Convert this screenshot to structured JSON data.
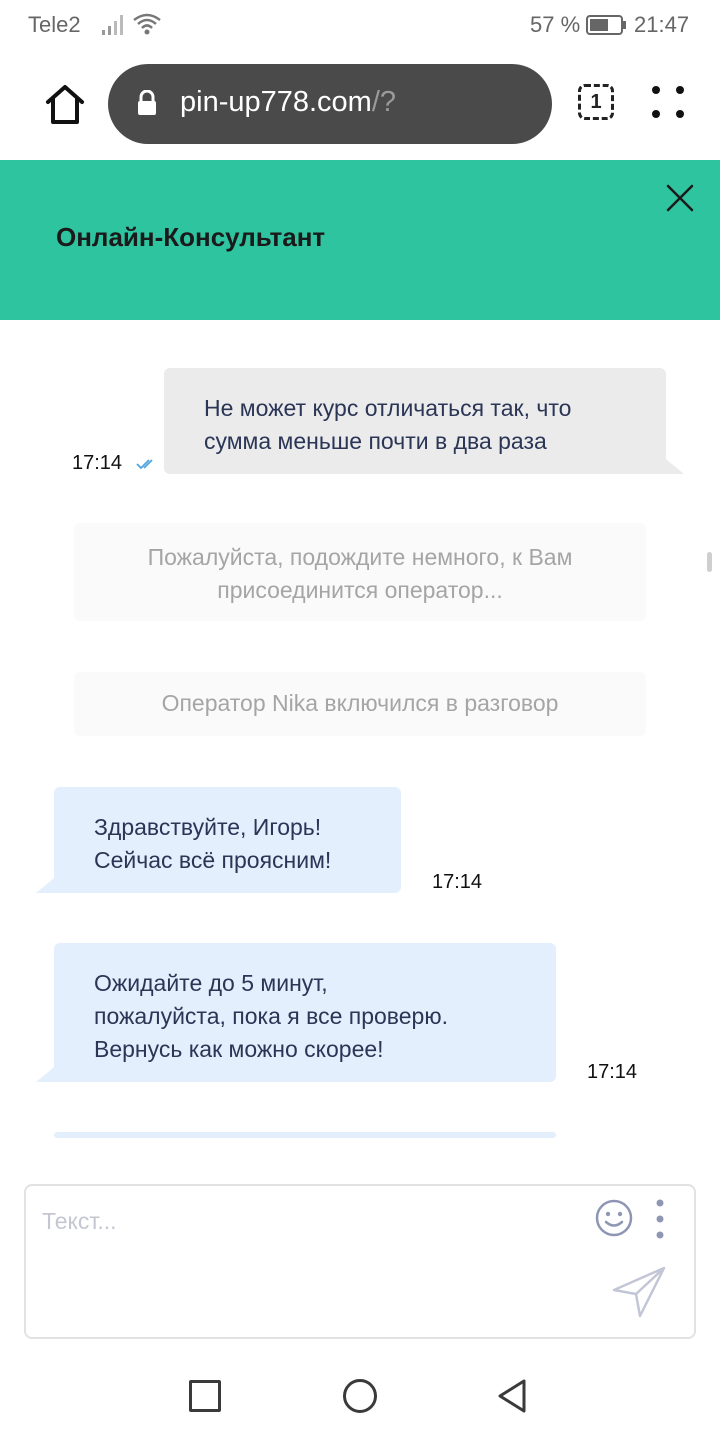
{
  "status_bar": {
    "carrier": "Tele2",
    "battery_percent": "57 %",
    "time": "21:47"
  },
  "browser": {
    "url_domain": "pin-up778.com",
    "url_path": "/?",
    "tab_count": "1"
  },
  "chat": {
    "title": "Онлайн-Консультант",
    "messages": [
      {
        "from": "user",
        "lines": [
          "Не может курс отличаться так, что",
          "сумма меньше почти в два раза"
        ],
        "time": "17:14"
      },
      {
        "from": "system",
        "lines": [
          "Пожалуйста, подождите немного, к Вам",
          "присоединится оператор..."
        ]
      },
      {
        "from": "system",
        "lines": [
          "Оператор Nika включился в разговор"
        ]
      },
      {
        "from": "operator",
        "lines": [
          "Здравствуйте, Игорь!",
          "Сейчас всё проясним!"
        ],
        "time": "17:14"
      },
      {
        "from": "operator",
        "lines": [
          "Ожидайте до 5 минут,",
          "пожалуйста, пока я все проверю.",
          "Вернусь как можно скорее!"
        ],
        "time": "17:14"
      }
    ]
  },
  "composer": {
    "placeholder": "Текст..."
  },
  "colors": {
    "header_bg": "#2fc4a0",
    "user_bubble": "#ebebeb",
    "operator_bubble": "#e3effc",
    "system_bubble": "#fafafa",
    "read_check": "#4fa3e0"
  },
  "icons": {
    "home": "home-icon",
    "lock": "lock-icon",
    "tabs": "tabs-icon",
    "menu": "more-icon",
    "close": "close-icon",
    "emoji": "smiley-icon",
    "send": "send-icon",
    "nav_recent": "square-icon",
    "nav_home": "circle-icon",
    "nav_back": "triangle-back-icon"
  }
}
